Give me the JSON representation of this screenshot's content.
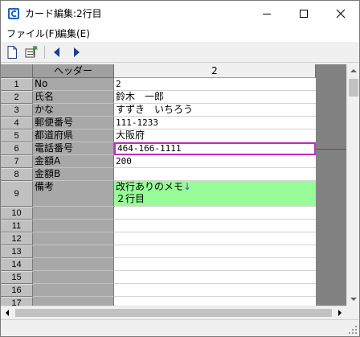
{
  "window": {
    "title": "カード編集:2行目"
  },
  "menu": {
    "file": "ファイル(F)",
    "edit": "編集(E)"
  },
  "toolbar": {
    "icons": [
      "new-document-icon",
      "flag-icon",
      "previous-record-icon",
      "next-record-icon"
    ]
  },
  "grid": {
    "header_label": "ヘッダー",
    "header_column": "2",
    "rows": [
      {
        "num": "1",
        "label": "No",
        "value": "2"
      },
      {
        "num": "2",
        "label": "氏名",
        "value": "鈴木　一郎"
      },
      {
        "num": "3",
        "label": "かな",
        "value": "すずき　いちろう"
      },
      {
        "num": "4",
        "label": "郵便番号",
        "value": "111-1233"
      },
      {
        "num": "5",
        "label": "都道府県",
        "value": "大阪府"
      },
      {
        "num": "6",
        "label": "電話番号",
        "value": "464-166-1111"
      },
      {
        "num": "7",
        "label": "金額A",
        "value": "200"
      },
      {
        "num": "8",
        "label": "金額B",
        "value": ""
      },
      {
        "num": "9",
        "label": "備考",
        "value_line1": "改行ありのメモ",
        "newline_mark": "↓",
        "value_line2": "２行目"
      },
      {
        "num": "10",
        "label": "",
        "value": ""
      },
      {
        "num": "11",
        "label": "",
        "value": ""
      },
      {
        "num": "12",
        "label": "",
        "value": ""
      },
      {
        "num": "13",
        "label": "",
        "value": ""
      },
      {
        "num": "14",
        "label": "",
        "value": ""
      },
      {
        "num": "15",
        "label": "",
        "value": ""
      },
      {
        "num": "16",
        "label": "",
        "value": ""
      },
      {
        "num": "17",
        "label": "",
        "value": ""
      }
    ]
  },
  "colors": {
    "memo_highlight": "#98fb98",
    "selection_border": "#c030c0",
    "header_gray": "#a0a0a0",
    "label_gray": "#a8a8a8",
    "dark_column": "#828282"
  }
}
